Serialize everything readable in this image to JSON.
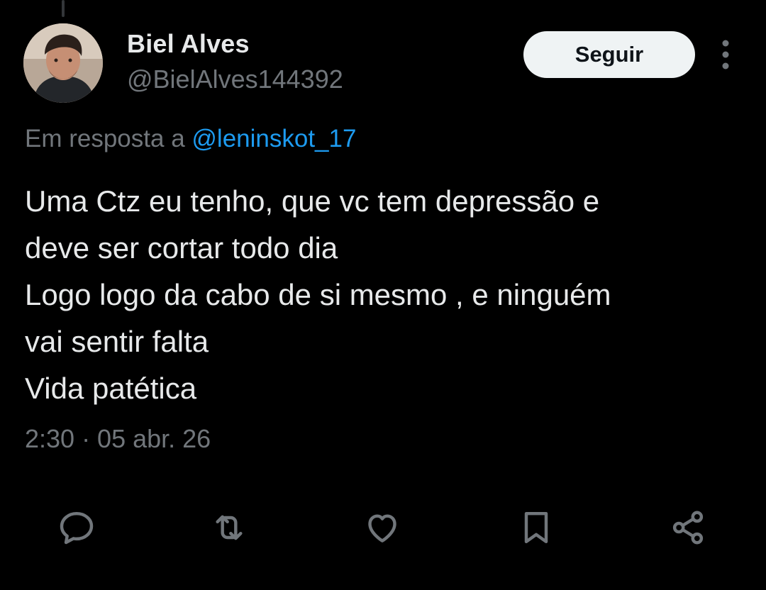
{
  "tweet": {
    "author_name": "Biel Alves",
    "author_handle": "@BielAlves144392",
    "follow_label": "Seguir",
    "reply_prefix": "Em resposta a",
    "reply_mention": "@leninskot_17",
    "lines": [
      "Uma Ctz eu tenho, que vc tem depressão e",
      "deve ser cortar todo dia",
      "Logo logo da cabo de si mesmo , e ninguém",
      "vai sentir falta",
      "Vida patética"
    ],
    "timestamp": "2:30 · 05 abr. 26"
  },
  "icons": {
    "more": "more-vertical-icon",
    "reply": "reply-icon",
    "retweet": "retweet-icon",
    "like": "heart-icon",
    "bookmark": "bookmark-icon",
    "share": "share-icon"
  },
  "colors": {
    "background": "#000000",
    "text": "#e7e9ea",
    "muted": "#71767b",
    "link": "#1d9bf0",
    "button_bg": "#eff3f4"
  }
}
